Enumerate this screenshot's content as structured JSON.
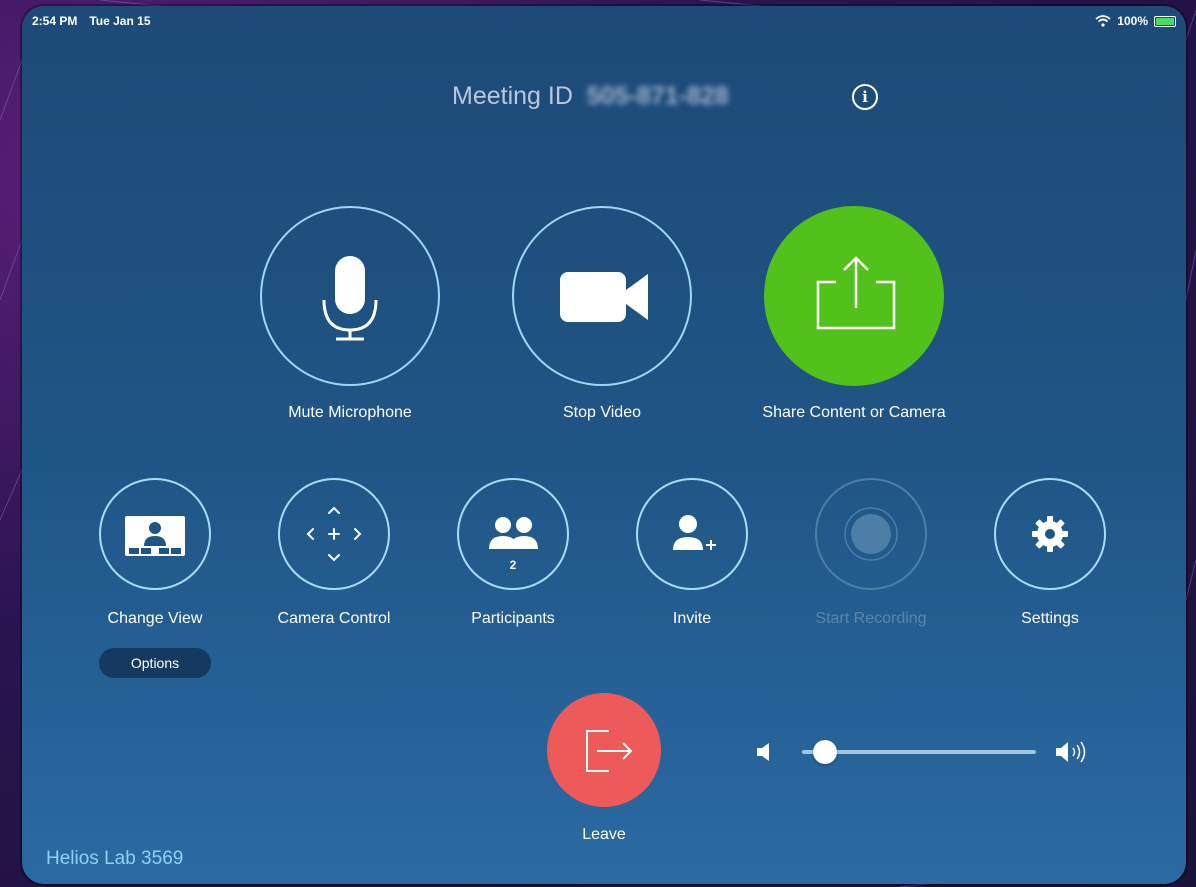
{
  "status_bar": {
    "time": "2:54 PM",
    "date": "Tue Jan 15",
    "battery": "100%"
  },
  "meeting": {
    "label": "Meeting ID",
    "id": "505-871-828",
    "info_icon": "i"
  },
  "main_actions": [
    {
      "label": "Mute Microphone",
      "icon": "microphone-icon"
    },
    {
      "label": "Stop Video",
      "icon": "video-camera-icon"
    },
    {
      "label": "Share Content or Camera",
      "icon": "share-icon",
      "color": "#52c21b"
    }
  ],
  "secondary_actions": [
    {
      "label": "Change View",
      "icon": "layout-icon"
    },
    {
      "label": "Camera Control",
      "icon": "camera-control-icon"
    },
    {
      "label": "Participants",
      "icon": "participants-icon",
      "count": "2"
    },
    {
      "label": "Invite",
      "icon": "invite-icon"
    },
    {
      "label": "Start Recording",
      "icon": "record-icon",
      "disabled": true
    },
    {
      "label": "Settings",
      "icon": "gear-icon"
    }
  ],
  "options_label": "Options",
  "leave": {
    "label": "Leave",
    "color": "#ee5a5a"
  },
  "volume": {
    "level": 0.05
  },
  "room_name": "Helios Lab 3569"
}
